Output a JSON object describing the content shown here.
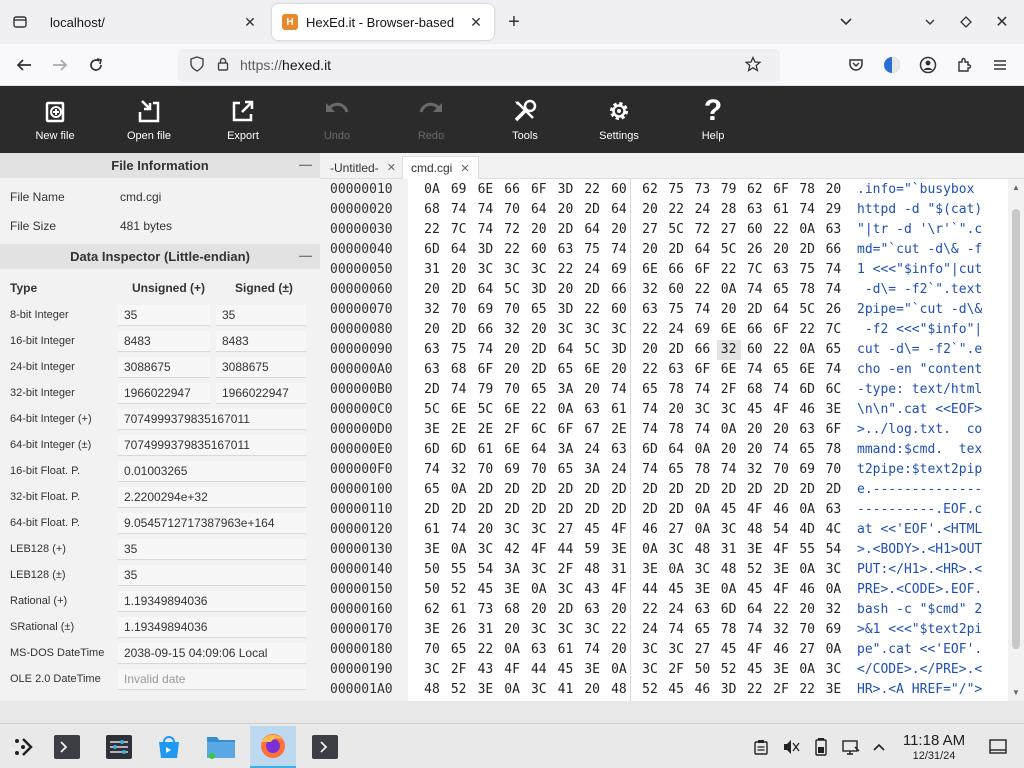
{
  "browser": {
    "tabs": [
      {
        "title": "localhost/",
        "active": false
      },
      {
        "title": "HexEd.it - Browser-based",
        "active": true
      }
    ],
    "url_prefix": "https://",
    "url_domain": "hexed.it"
  },
  "toolbar": {
    "items": [
      {
        "label": "New file",
        "icon": "new-file-icon",
        "enabled": true
      },
      {
        "label": "Open file",
        "icon": "open-file-icon",
        "enabled": true
      },
      {
        "label": "Export",
        "icon": "export-icon",
        "enabled": true
      },
      {
        "label": "Undo",
        "icon": "undo-icon",
        "enabled": false
      },
      {
        "label": "Redo",
        "icon": "redo-icon",
        "enabled": false
      },
      {
        "label": "Tools",
        "icon": "tools-icon",
        "enabled": true
      },
      {
        "label": "Settings",
        "icon": "gear-icon",
        "enabled": true
      },
      {
        "label": "Help",
        "icon": "help-icon",
        "enabled": true
      }
    ]
  },
  "file_info": {
    "title": "File Information",
    "rows": [
      {
        "key": "File Name",
        "value": "cmd.cgi"
      },
      {
        "key": "File Size",
        "value": "481 bytes"
      }
    ]
  },
  "data_inspector": {
    "title": "Data Inspector (Little-endian)",
    "headers": {
      "type": "Type",
      "unsigned": "Unsigned (+)",
      "signed": "Signed (±)"
    },
    "rows": [
      {
        "type": "8-bit Integer",
        "unsigned": "35",
        "signed": "35"
      },
      {
        "type": "16-bit Integer",
        "unsigned": "8483",
        "signed": "8483"
      },
      {
        "type": "24-bit Integer",
        "unsigned": "3088675",
        "signed": "3088675"
      },
      {
        "type": "32-bit Integer",
        "unsigned": "1966022947",
        "signed": "1966022947"
      },
      {
        "type": "64-bit Integer (+)",
        "value": "7074999379835167011"
      },
      {
        "type": "64-bit Integer (±)",
        "value": "7074999379835167011"
      },
      {
        "type": "16-bit Float. P.",
        "value": "0.01003265"
      },
      {
        "type": "32-bit Float. P.",
        "value": "2.2200294e+32"
      },
      {
        "type": "64-bit Float. P.",
        "value": "9.0545712717387963e+164"
      },
      {
        "type": "LEB128 (+)",
        "value": "35"
      },
      {
        "type": "LEB128 (±)",
        "value": "35"
      },
      {
        "type": "Rational (+)",
        "value": "1.19349894036"
      },
      {
        "type": "SRational (±)",
        "value": "1.19349894036"
      },
      {
        "type": "MS-DOS DateTime",
        "value": "2038-09-15 04:09:06 Local"
      },
      {
        "type": "OLE 2.0 DateTime",
        "value": "Invalid date",
        "muted": true
      }
    ]
  },
  "editor": {
    "tabs": [
      {
        "label": "-Untitled-",
        "active": false
      },
      {
        "label": "cmd.cgi",
        "active": true
      }
    ],
    "selected": {
      "row": 8,
      "col": 11
    },
    "rows": [
      {
        "offset": "00000010",
        "bytes": [
          "0A",
          "69",
          "6E",
          "66",
          "6F",
          "3D",
          "22",
          "60",
          "62",
          "75",
          "73",
          "79",
          "62",
          "6F",
          "78",
          "20"
        ],
        "ascii": ".info=\"`busybox "
      },
      {
        "offset": "00000020",
        "bytes": [
          "68",
          "74",
          "74",
          "70",
          "64",
          "20",
          "2D",
          "64",
          "20",
          "22",
          "24",
          "28",
          "63",
          "61",
          "74",
          "29"
        ],
        "ascii": "httpd -d \"$(cat)"
      },
      {
        "offset": "00000030",
        "bytes": [
          "22",
          "7C",
          "74",
          "72",
          "20",
          "2D",
          "64",
          "20",
          "27",
          "5C",
          "72",
          "27",
          "60",
          "22",
          "0A",
          "63"
        ],
        "ascii": "\"|tr -d '\\r'`\".c"
      },
      {
        "offset": "00000040",
        "bytes": [
          "6D",
          "64",
          "3D",
          "22",
          "60",
          "63",
          "75",
          "74",
          "20",
          "2D",
          "64",
          "5C",
          "26",
          "20",
          "2D",
          "66"
        ],
        "ascii": "md=\"`cut -d\\& -f"
      },
      {
        "offset": "00000050",
        "bytes": [
          "31",
          "20",
          "3C",
          "3C",
          "3C",
          "22",
          "24",
          "69",
          "6E",
          "66",
          "6F",
          "22",
          "7C",
          "63",
          "75",
          "74"
        ],
        "ascii": "1 <<<\"$info\"|cut"
      },
      {
        "offset": "00000060",
        "bytes": [
          "20",
          "2D",
          "64",
          "5C",
          "3D",
          "20",
          "2D",
          "66",
          "32",
          "60",
          "22",
          "0A",
          "74",
          "65",
          "78",
          "74"
        ],
        "ascii": " -d\\= -f2`\".text"
      },
      {
        "offset": "00000070",
        "bytes": [
          "32",
          "70",
          "69",
          "70",
          "65",
          "3D",
          "22",
          "60",
          "63",
          "75",
          "74",
          "20",
          "2D",
          "64",
          "5C",
          "26"
        ],
        "ascii": "2pipe=\"`cut -d\\&"
      },
      {
        "offset": "00000080",
        "bytes": [
          "20",
          "2D",
          "66",
          "32",
          "20",
          "3C",
          "3C",
          "3C",
          "22",
          "24",
          "69",
          "6E",
          "66",
          "6F",
          "22",
          "7C"
        ],
        "ascii": " -f2 <<<\"$info\"|"
      },
      {
        "offset": "00000090",
        "bytes": [
          "63",
          "75",
          "74",
          "20",
          "2D",
          "64",
          "5C",
          "3D",
          "20",
          "2D",
          "66",
          "32",
          "60",
          "22",
          "0A",
          "65"
        ],
        "ascii": "cut -d\\= -f2`\".e"
      },
      {
        "offset": "000000A0",
        "bytes": [
          "63",
          "68",
          "6F",
          "20",
          "2D",
          "65",
          "6E",
          "20",
          "22",
          "63",
          "6F",
          "6E",
          "74",
          "65",
          "6E",
          "74"
        ],
        "ascii": "cho -en \"content"
      },
      {
        "offset": "000000B0",
        "bytes": [
          "2D",
          "74",
          "79",
          "70",
          "65",
          "3A",
          "20",
          "74",
          "65",
          "78",
          "74",
          "2F",
          "68",
          "74",
          "6D",
          "6C"
        ],
        "ascii": "-type: text/html"
      },
      {
        "offset": "000000C0",
        "bytes": [
          "5C",
          "6E",
          "5C",
          "6E",
          "22",
          "0A",
          "63",
          "61",
          "74",
          "20",
          "3C",
          "3C",
          "45",
          "4F",
          "46",
          "3E"
        ],
        "ascii": "\\n\\n\".cat <<EOF>"
      },
      {
        "offset": "000000D0",
        "bytes": [
          "3E",
          "2E",
          "2E",
          "2F",
          "6C",
          "6F",
          "67",
          "2E",
          "74",
          "78",
          "74",
          "0A",
          "20",
          "20",
          "63",
          "6F"
        ],
        "ascii": ">../log.txt.  co"
      },
      {
        "offset": "000000E0",
        "bytes": [
          "6D",
          "6D",
          "61",
          "6E",
          "64",
          "3A",
          "24",
          "63",
          "6D",
          "64",
          "0A",
          "20",
          "20",
          "74",
          "65",
          "78"
        ],
        "ascii": "mmand:$cmd.  tex"
      },
      {
        "offset": "000000F0",
        "bytes": [
          "74",
          "32",
          "70",
          "69",
          "70",
          "65",
          "3A",
          "24",
          "74",
          "65",
          "78",
          "74",
          "32",
          "70",
          "69",
          "70"
        ],
        "ascii": "t2pipe:$text2pip"
      },
      {
        "offset": "00000100",
        "bytes": [
          "65",
          "0A",
          "2D",
          "2D",
          "2D",
          "2D",
          "2D",
          "2D",
          "2D",
          "2D",
          "2D",
          "2D",
          "2D",
          "2D",
          "2D",
          "2D"
        ],
        "ascii": "e.--------------"
      },
      {
        "offset": "00000110",
        "bytes": [
          "2D",
          "2D",
          "2D",
          "2D",
          "2D",
          "2D",
          "2D",
          "2D",
          "2D",
          "2D",
          "0A",
          "45",
          "4F",
          "46",
          "0A",
          "63"
        ],
        "ascii": "----------.EOF.c"
      },
      {
        "offset": "00000120",
        "bytes": [
          "61",
          "74",
          "20",
          "3C",
          "3C",
          "27",
          "45",
          "4F",
          "46",
          "27",
          "0A",
          "3C",
          "48",
          "54",
          "4D",
          "4C"
        ],
        "ascii": "at <<'EOF'.<HTML"
      },
      {
        "offset": "00000130",
        "bytes": [
          "3E",
          "0A",
          "3C",
          "42",
          "4F",
          "44",
          "59",
          "3E",
          "0A",
          "3C",
          "48",
          "31",
          "3E",
          "4F",
          "55",
          "54"
        ],
        "ascii": ">.<BODY>.<H1>OUT"
      },
      {
        "offset": "00000140",
        "bytes": [
          "50",
          "55",
          "54",
          "3A",
          "3C",
          "2F",
          "48",
          "31",
          "3E",
          "0A",
          "3C",
          "48",
          "52",
          "3E",
          "0A",
          "3C"
        ],
        "ascii": "PUT:</H1>.<HR>.<"
      },
      {
        "offset": "00000150",
        "bytes": [
          "50",
          "52",
          "45",
          "3E",
          "0A",
          "3C",
          "43",
          "4F",
          "44",
          "45",
          "3E",
          "0A",
          "45",
          "4F",
          "46",
          "0A"
        ],
        "ascii": "PRE>.<CODE>.EOF."
      },
      {
        "offset": "00000160",
        "bytes": [
          "62",
          "61",
          "73",
          "68",
          "20",
          "2D",
          "63",
          "20",
          "22",
          "24",
          "63",
          "6D",
          "64",
          "22",
          "20",
          "32"
        ],
        "ascii": "bash -c \"$cmd\" 2"
      },
      {
        "offset": "00000170",
        "bytes": [
          "3E",
          "26",
          "31",
          "20",
          "3C",
          "3C",
          "3C",
          "22",
          "24",
          "74",
          "65",
          "78",
          "74",
          "32",
          "70",
          "69"
        ],
        "ascii": ">&1 <<<\"$text2pi"
      },
      {
        "offset": "00000180",
        "bytes": [
          "70",
          "65",
          "22",
          "0A",
          "63",
          "61",
          "74",
          "20",
          "3C",
          "3C",
          "27",
          "45",
          "4F",
          "46",
          "27",
          "0A"
        ],
        "ascii": "pe\".cat <<'EOF'."
      },
      {
        "offset": "00000190",
        "bytes": [
          "3C",
          "2F",
          "43",
          "4F",
          "44",
          "45",
          "3E",
          "0A",
          "3C",
          "2F",
          "50",
          "52",
          "45",
          "3E",
          "0A",
          "3C"
        ],
        "ascii": "</CODE>.</PRE>.<"
      },
      {
        "offset": "000001A0",
        "bytes": [
          "48",
          "52",
          "3E",
          "0A",
          "3C",
          "41",
          "20",
          "48",
          "52",
          "45",
          "46",
          "3D",
          "22",
          "2F",
          "22",
          "3E"
        ],
        "ascii": "HR>.<A HREF=\"/\">"
      }
    ]
  },
  "taskbar": {
    "apps": [
      "application-launcher-icon",
      "terminal-icon",
      "system-settings-icon",
      "app-store-icon",
      "file-manager-icon",
      "firefox-icon",
      "konsole-icon"
    ],
    "time": "11:18 AM",
    "date": "12/31/24"
  }
}
